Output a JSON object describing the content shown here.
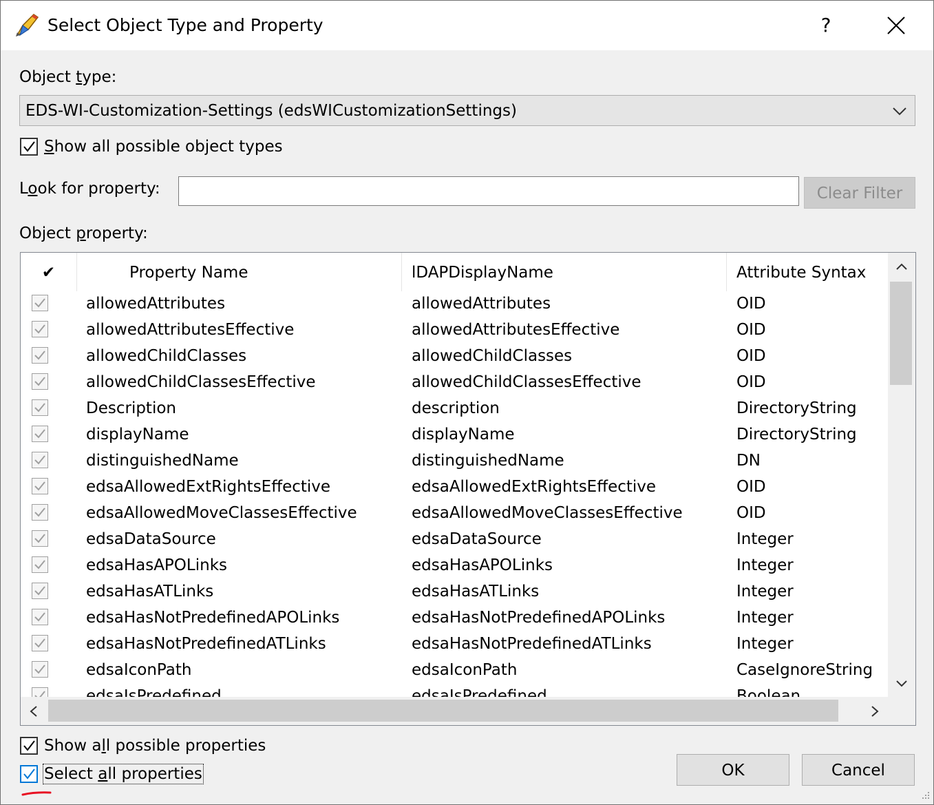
{
  "window": {
    "title": "Select Object Type and Property",
    "help_label": "?"
  },
  "object_type": {
    "label_pre": "Object ",
    "label_u": "t",
    "label_post": "ype:",
    "selected": "EDS-WI-Customization-Settings (edsWICustomizationSettings)"
  },
  "show_all_types": {
    "label_u": "S",
    "label_post": "how all possible object types",
    "checked": true
  },
  "look_for": {
    "label_pre": "L",
    "label_u": "o",
    "label_post": "ok for property:",
    "value": "",
    "clear_label": "Clear Filter"
  },
  "object_property": {
    "label_pre": "Object ",
    "label_u": "p",
    "label_post": "roperty:"
  },
  "table": {
    "check_header": "✔",
    "columns": [
      "Property Name",
      "lDAPDisplayName",
      "Attribute Syntax"
    ],
    "rows": [
      {
        "name": "allowedAttributes",
        "ldap": "allowedAttributes",
        "syntax": "OID"
      },
      {
        "name": "allowedAttributesEffective",
        "ldap": "allowedAttributesEffective",
        "syntax": "OID"
      },
      {
        "name": "allowedChildClasses",
        "ldap": "allowedChildClasses",
        "syntax": "OID"
      },
      {
        "name": "allowedChildClassesEffective",
        "ldap": "allowedChildClassesEffective",
        "syntax": "OID"
      },
      {
        "name": "Description",
        "ldap": "description",
        "syntax": "DirectoryString"
      },
      {
        "name": "displayName",
        "ldap": "displayName",
        "syntax": "DirectoryString"
      },
      {
        "name": "distinguishedName",
        "ldap": "distinguishedName",
        "syntax": "DN"
      },
      {
        "name": "edsaAllowedExtRightsEffective",
        "ldap": "edsaAllowedExtRightsEffective",
        "syntax": "OID"
      },
      {
        "name": "edsaAllowedMoveClassesEffective",
        "ldap": "edsaAllowedMoveClassesEffective",
        "syntax": "OID"
      },
      {
        "name": "edsaDataSource",
        "ldap": "edsaDataSource",
        "syntax": "Integer"
      },
      {
        "name": "edsaHasAPOLinks",
        "ldap": "edsaHasAPOLinks",
        "syntax": "Integer"
      },
      {
        "name": "edsaHasATLinks",
        "ldap": "edsaHasATLinks",
        "syntax": "Integer"
      },
      {
        "name": "edsaHasNotPredefinedAPOLinks",
        "ldap": "edsaHasNotPredefinedAPOLinks",
        "syntax": "Integer"
      },
      {
        "name": "edsaHasNotPredefinedATLinks",
        "ldap": "edsaHasNotPredefinedATLinks",
        "syntax": "Integer"
      },
      {
        "name": "edsaIconPath",
        "ldap": "edsaIconPath",
        "syntax": "CaseIgnoreString"
      },
      {
        "name": "edsaIsPredefined",
        "ldap": "edsaIsPredefined",
        "syntax": "Boolean"
      }
    ]
  },
  "show_all_props": {
    "label_pre": "Show a",
    "label_u": "l",
    "label_post": "l possible properties",
    "checked": true
  },
  "select_all_props": {
    "label_pre": "Select ",
    "label_u": "a",
    "label_post": "ll properties",
    "checked": true
  },
  "buttons": {
    "ok": "OK",
    "cancel": "Cancel"
  },
  "colors": {
    "accent": "#0078d7",
    "annotation": "#e81123"
  }
}
